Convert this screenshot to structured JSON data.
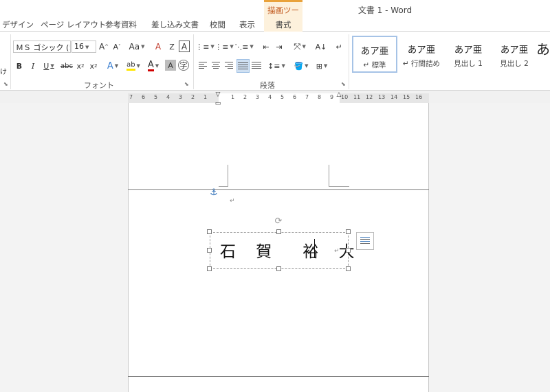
{
  "window": {
    "title": "文書 1 - Word",
    "context_tab_group": "描画ツール"
  },
  "tabs": [
    "デザイン",
    "ページ レイアウト",
    "参考資料",
    "差し込み文書",
    "校閲",
    "表示",
    "書式"
  ],
  "font_group": {
    "font_name": "ＭＳ ゴシック (!",
    "font_size": "16",
    "label": "フォント",
    "partial_label": "け"
  },
  "paragraph_group": {
    "label": "段落"
  },
  "styles": [
    {
      "preview": "あア亜",
      "name": "↵ 標準"
    },
    {
      "preview": "あア亜",
      "name": "↵ 行間詰め"
    },
    {
      "preview": "あア亜",
      "name": "見出し 1"
    },
    {
      "preview": "あア亜",
      "name": "見出し 2"
    },
    {
      "preview": "あ",
      "name": ""
    }
  ],
  "ruler_numbers": [
    "7",
    "6",
    "5",
    "4",
    "3",
    "2",
    "1",
    "1",
    "2",
    "3",
    "4",
    "5",
    "6",
    "7",
    "8",
    "9",
    "10",
    "11",
    "12",
    "13",
    "14",
    "15",
    "16"
  ],
  "textbox": {
    "text": "石 賀　裕 大"
  },
  "marks": {
    "paragraph": "↵",
    "anchor": "⚓"
  },
  "colors": {
    "accent_context": "#e9a23b",
    "context_text": "#c0561b",
    "selected_style_border": "#a6c3e6",
    "font_color_red": "#d00000",
    "highlight_yellow": "#ffe600"
  }
}
